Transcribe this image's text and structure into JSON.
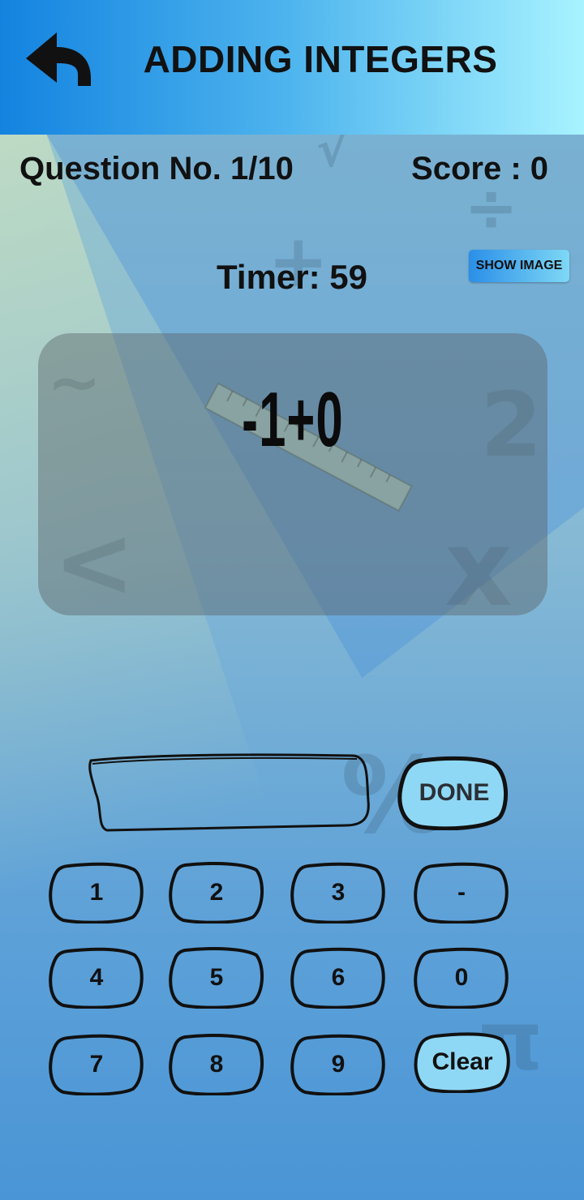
{
  "header": {
    "title": "ADDING INTEGERS",
    "back_icon": "back-arrow-icon"
  },
  "status": {
    "question_label": "Question No. 1/10",
    "score_label": "Score : 0",
    "timer_label": "Timer: 59",
    "show_image_label": "SHOW IMAGE"
  },
  "question": {
    "equation": "-1+0"
  },
  "answer": {
    "value": "",
    "done_label": "DONE"
  },
  "keypad": {
    "keys": [
      "1",
      "2",
      "3",
      "-",
      "4",
      "5",
      "6",
      "0",
      "7",
      "8",
      "9"
    ],
    "clear_label": "Clear"
  },
  "colors": {
    "header_start": "#1383e0",
    "header_end": "#a8f3ff",
    "highlight_button": "#8fd8f5"
  }
}
